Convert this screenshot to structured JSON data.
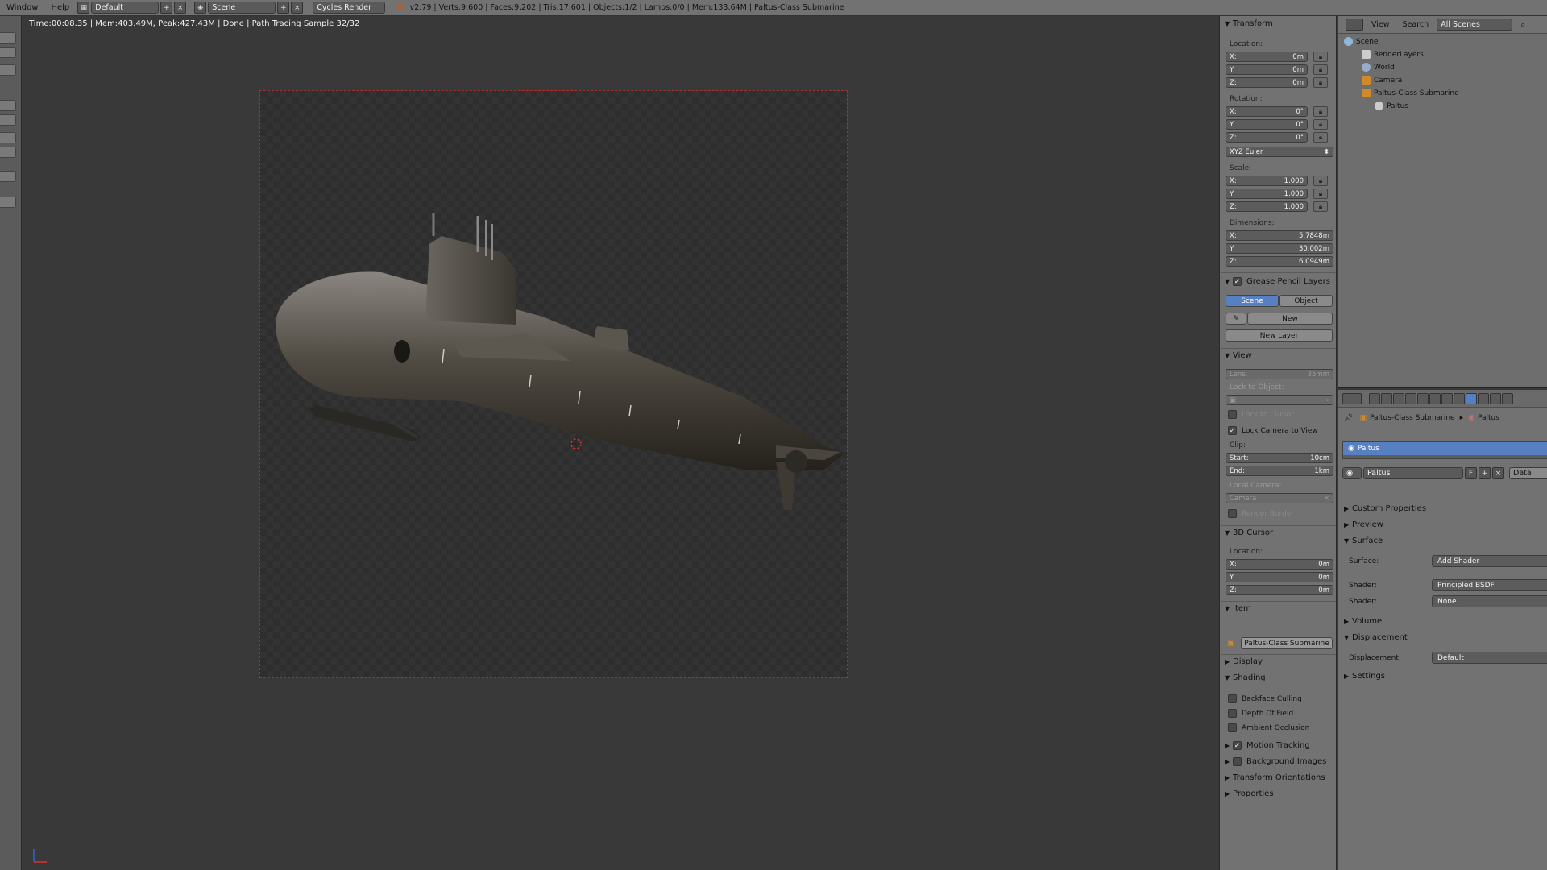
{
  "topbar": {
    "menu": [
      "Window",
      "Help"
    ],
    "screen_layout": "Default",
    "scene": "Scene",
    "render_engine": "Cycles Render",
    "info": "v2.79 | Verts:9,600 | Faces:9,202 | Tris:17,601 | Objects:1/2 | Lamps:0/0 | Mem:133.64M | Paltus-Class Submarine"
  },
  "viewport": {
    "status": "Time:00:08.35 | Mem:403.49M, Peak:427.43M | Done | Path Tracing Sample 32/32"
  },
  "npanel": {
    "transform": {
      "title": "Transform",
      "location_label": "Location:",
      "location": [
        {
          "axis": "X:",
          "value": "0m"
        },
        {
          "axis": "Y:",
          "value": "0m"
        },
        {
          "axis": "Z:",
          "value": "0m"
        }
      ],
      "rotation_label": "Rotation:",
      "rotation": [
        {
          "axis": "X:",
          "value": "0°"
        },
        {
          "axis": "Y:",
          "value": "0°"
        },
        {
          "axis": "Z:",
          "value": "0°"
        }
      ],
      "rotation_mode": "XYZ Euler",
      "scale_label": "Scale:",
      "scale": [
        {
          "axis": "X:",
          "value": "1.000"
        },
        {
          "axis": "Y:",
          "value": "1.000"
        },
        {
          "axis": "Z:",
          "value": "1.000"
        }
      ],
      "dimensions_label": "Dimensions:",
      "dimensions": [
        {
          "axis": "X:",
          "value": "5.7848m"
        },
        {
          "axis": "Y:",
          "value": "30.002m"
        },
        {
          "axis": "Z:",
          "value": "6.0949m"
        }
      ]
    },
    "grease_pencil": {
      "title": "Grease Pencil Layers",
      "tab_scene": "Scene",
      "tab_object": "Object",
      "new": "New",
      "new_layer": "New Layer"
    },
    "view": {
      "title": "View",
      "lens_label": "Lens:",
      "lens_value": "35mm",
      "lock_to_object": "Lock to Object:",
      "lock_to_cursor": "Lock to Cursor",
      "lock_camera": "Lock Camera to View",
      "clip_label": "Clip:",
      "clip_start_label": "Start:",
      "clip_start": "10cm",
      "clip_end_label": "End:",
      "clip_end": "1km",
      "local_camera": "Local Camera:",
      "camera": "Camera",
      "render_border": "Render Border"
    },
    "cursor": {
      "title": "3D Cursor",
      "location_label": "Location:",
      "location": [
        {
          "axis": "X:",
          "value": "0m"
        },
        {
          "axis": "Y:",
          "value": "0m"
        },
        {
          "axis": "Z:",
          "value": "0m"
        }
      ]
    },
    "item": {
      "title": "Item",
      "name": "Paltus-Class Submarine"
    },
    "display": "Display",
    "shading": {
      "title": "Shading",
      "backface": "Backface Culling",
      "dof": "Depth Of Field",
      "ao": "Ambient Occlusion"
    },
    "motion_tracking": "Motion Tracking",
    "background_images": "Background Images",
    "transform_orientations": "Transform Orientations",
    "properties": "Properties"
  },
  "outliner": {
    "view": "View",
    "search": "Search",
    "filter": "All Scenes",
    "items": [
      {
        "name": "Scene"
      },
      {
        "name": "RenderLayers"
      },
      {
        "name": "World"
      },
      {
        "name": "Camera"
      },
      {
        "name": "Paltus-Class Submarine"
      },
      {
        "name": "Paltus"
      }
    ]
  },
  "props": {
    "breadcrumb_object": "Paltus-Class Submarine",
    "breadcrumb_material": "Paltus",
    "slot": "Paltus",
    "material_name": "Paltus",
    "fake_user": "F",
    "data": "Data",
    "custom_properties": "Custom Properties",
    "preview": "Preview",
    "surface": "Surface",
    "surface_label": "Surface:",
    "surface_value": "Add Shader",
    "shader_label": "Shader:",
    "shader1": "Principled BSDF",
    "shader2": "None",
    "volume": "Volume",
    "displacement": "Displacement",
    "displacement_label": "Displacement:",
    "displacement_value": "Default",
    "settings": "Settings"
  }
}
